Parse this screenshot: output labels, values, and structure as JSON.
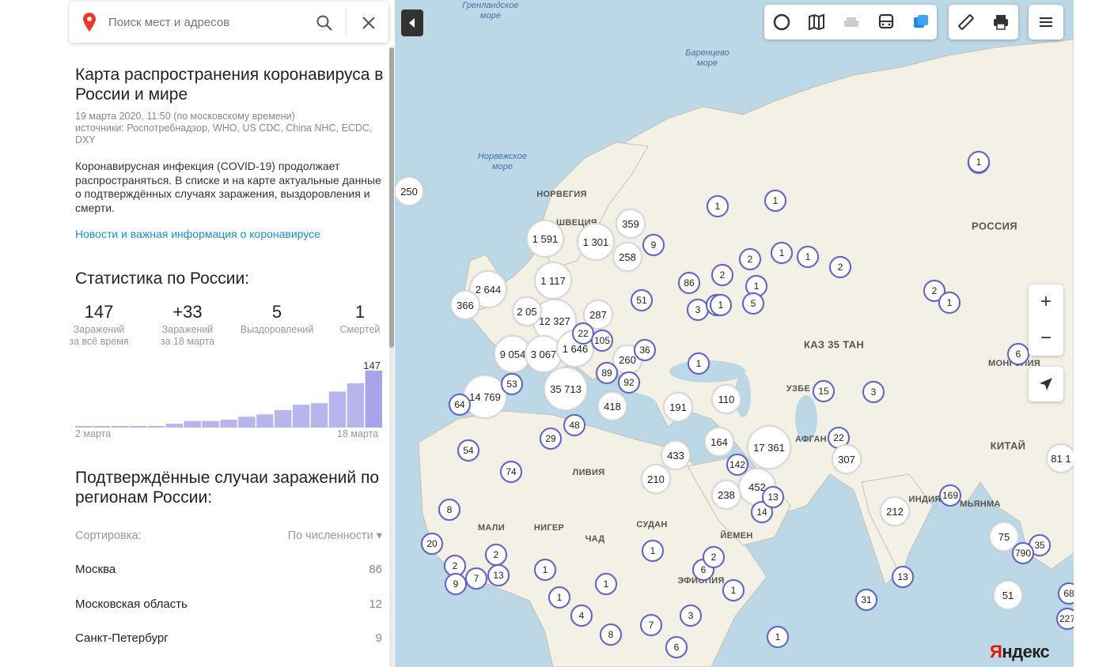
{
  "search": {
    "placeholder": "Поиск мест и адресов"
  },
  "article": {
    "title": "Карта распространения коронавируса в России и мире",
    "date": "19 марта 2020, 11:50 (по московскому времени)",
    "sources": "источники: Роспотребнадзор, WHO, US CDC, China NHC, ECDC, DXY",
    "description": "Коронавирусная инфекция (COVID-19) продолжает распространяться. В списке и на карте актуальные данные о подтверждённых случаях заражения, выздоровления и смерти.",
    "news_link": "Новости и важная информация о коронавирусе"
  },
  "stats": {
    "title": "Статистика по России:",
    "items": [
      {
        "value": "147",
        "label1": "Заражений",
        "label2": "за всё время"
      },
      {
        "value": "+33",
        "label1": "Заражений",
        "label2": "за 18 марта"
      },
      {
        "value": "5",
        "label1": "Выздоровлений",
        "label2": ""
      },
      {
        "value": "1",
        "label1": "Смертей",
        "label2": ""
      }
    ],
    "chart_data": {
      "type": "bar",
      "categories": [
        "2 марта",
        "3 марта",
        "4 марта",
        "5 марта",
        "6 марта",
        "7 марта",
        "8 марта",
        "9 марта",
        "10 марта",
        "11 марта",
        "12 марта",
        "13 марта",
        "14 марта",
        "15 марта",
        "16 марта",
        "17 марта",
        "18 марта"
      ],
      "values": [
        3,
        3,
        3,
        3,
        4,
        10,
        17,
        17,
        20,
        28,
        34,
        45,
        59,
        63,
        93,
        114,
        147
      ],
      "x_start_label": "2 марта",
      "x_end_label": "18 марта",
      "max_label": "147",
      "bar_color": "#b8b4ee",
      "last_bar_color": "#a9a3ec"
    }
  },
  "regions": {
    "title": "Подтверждённые случаи заражений по регионам России:",
    "sort_label": "Сортировка:",
    "sort_value": "По численности ▾",
    "items": [
      {
        "name": "Москва",
        "count": "86"
      },
      {
        "name": "Московская область",
        "count": "12"
      },
      {
        "name": "Санкт-Петербург",
        "count": "9"
      }
    ]
  },
  "map": {
    "sea_labels": [
      {
        "text": "Гренландское\nморе"
      },
      {
        "text": "Баренцево\nморе"
      },
      {
        "text": "Норвежское\nморе"
      }
    ],
    "country_labels": [
      "НОРВЕГИЯ",
      "ШВЕЦИЯ",
      "РОССИЯ",
      "КАЗ  35  ТАН",
      "МОНГОЛИЯ",
      "КИТАЙ",
      "ЛИВИЯ",
      "СУДАН",
      "МАЛИ",
      "НИГЕР",
      "ЧАД",
      "ЙЕМЕН",
      "ЭФИОПИЯ",
      "ИНДИЯ",
      "МЬЯНМА",
      "АФГАН",
      "УЗБЕ"
    ],
    "clusters": [
      "250",
      "1 591",
      "1 301",
      "359",
      "258",
      "9",
      "1 117",
      "2 644",
      "366",
      "12 327",
      "287",
      "2 05",
      "51",
      "86",
      "3",
      "1",
      "9 054",
      "3 067",
      "1 646",
      "260",
      "89",
      "92",
      "36",
      "14 769",
      "35 713",
      "418",
      "53",
      "48",
      "191",
      "110",
      "29",
      "54",
      "74",
      "433",
      "164",
      "17 361",
      "210",
      "238",
      "452",
      "142",
      "15",
      "3",
      "22",
      "307",
      "1",
      "1",
      "2",
      "1",
      "1",
      "2",
      "1",
      "2",
      "1",
      "5",
      "1",
      "6",
      "1",
      "2",
      "1",
      "14",
      "169",
      "212",
      "75",
      "35",
      "790",
      "51",
      "13",
      "31",
      "20",
      "2",
      "8",
      "1",
      "2",
      "9",
      "7",
      "13",
      "1",
      "1",
      "4",
      "8",
      "7",
      "3",
      "6",
      "6",
      "1",
      "1",
      "2",
      "1",
      "81 1",
      "64",
      "22",
      "105",
      "13",
      "68",
      "227",
      "1"
    ],
    "toolbar_icons": [
      "traffic-circle-icon",
      "layers-map-icon",
      "taxi-icon",
      "bus-icon",
      "panorama-icon",
      "ruler-icon",
      "print-icon",
      "menu-icon"
    ],
    "zoom_in": "+",
    "zoom_out": "−",
    "logo": "Яндекс"
  }
}
